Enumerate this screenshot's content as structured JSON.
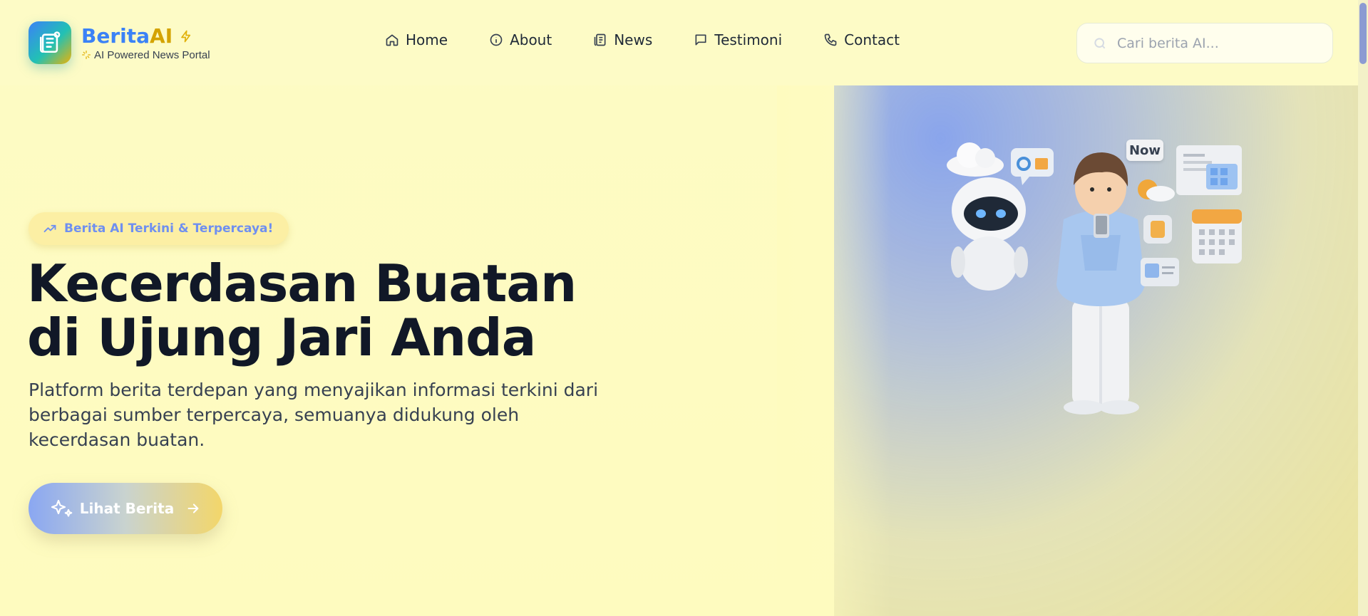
{
  "brand": {
    "name_part1": "Berita",
    "name_part2": "AI",
    "tagline": "AI Powered News Portal",
    "colors": {
      "blue": "#3b82f6",
      "gold": "#d4a300",
      "teal": "#22c1b4"
    }
  },
  "nav": {
    "items": [
      {
        "label": "Home",
        "icon": "home-icon"
      },
      {
        "label": "About",
        "icon": "info-icon"
      },
      {
        "label": "News",
        "icon": "newspaper-icon"
      },
      {
        "label": "Testimoni",
        "icon": "message-icon"
      },
      {
        "label": "Contact",
        "icon": "phone-icon"
      }
    ]
  },
  "search": {
    "placeholder": "Cari berita AI...",
    "value": ""
  },
  "hero": {
    "badge": "Berita AI Terkini & Terpercaya!",
    "title_line1": "Kecerdasan Buatan",
    "title_line2": "di Ujung Jari Anda",
    "description": "Platform berita terdepan yang menyajikan informasi terkini dari berbagai sumber terpercaya, semuanya didukung oleh kecerdasan buatan.",
    "cta_label": "Lihat Berita",
    "illustration_tag": "Now"
  }
}
